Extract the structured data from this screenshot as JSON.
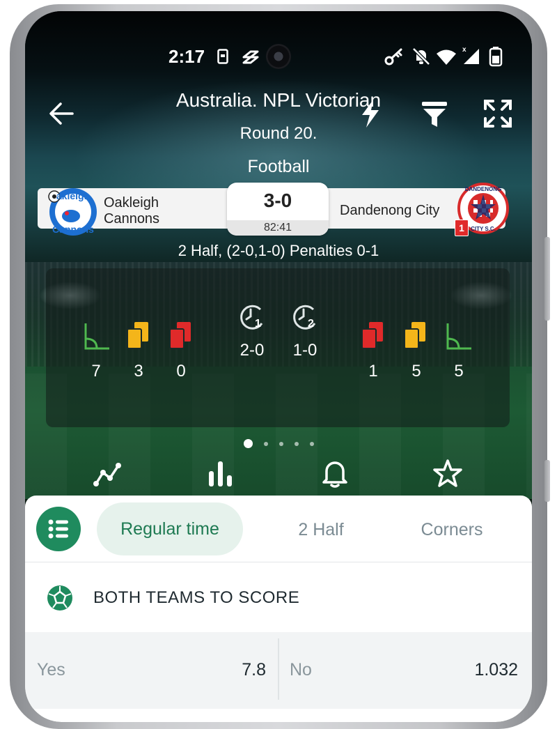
{
  "status_bar": {
    "time": "2:17"
  },
  "header": {
    "title": "Australia. NPL Victorian",
    "round": "Round 20.",
    "sport": "Football"
  },
  "match": {
    "home_team_line1": "Oakleigh",
    "home_team_line2": "Cannons",
    "away_team": "Dandenong City",
    "score": "3-0",
    "clock": "82:41",
    "away_red_card_badge": "1",
    "period_info": "2 Half, (2-0,1-0) Penalties 0-1",
    "home_logo_text": "Oakleigh Cannons",
    "away_logo_text": "Dandenong City S.C."
  },
  "stats": {
    "home_corners": "7",
    "home_yellow": "3",
    "home_red": "0",
    "half1_label": "1",
    "half2_label": "2",
    "half1_score": "2-0",
    "half2_score": "1-0",
    "away_red": "1",
    "away_yellow": "5",
    "away_corners": "5"
  },
  "tabs": {
    "regular_time": "Regular time",
    "second_half": "2 Half",
    "corners": "Corners"
  },
  "market": {
    "title": "BOTH TEAMS TO SCORE",
    "yes_label": "Yes",
    "yes_odds": "7.8",
    "no_label": "No",
    "no_odds": "1.032"
  },
  "colors": {
    "accent_green": "#1f8b5e",
    "yellow_card": "#f4b51a",
    "red_card": "#e02a2a",
    "corner_flag": "#4fb84f"
  }
}
